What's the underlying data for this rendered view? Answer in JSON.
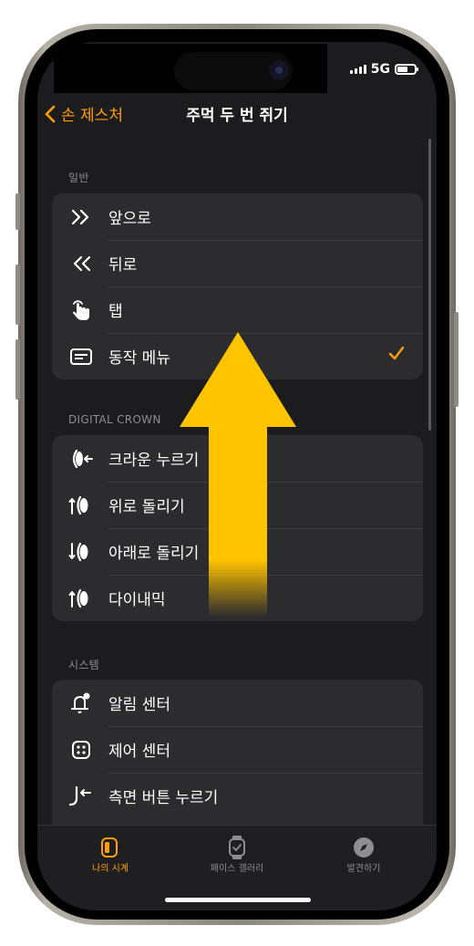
{
  "status": {
    "network": "5G"
  },
  "nav": {
    "back_label": "손 제스처",
    "title": "주먹 두 번 쥐기"
  },
  "accent_color": "#ff9f0a",
  "sections": {
    "general": {
      "header": "일반",
      "items": [
        {
          "label": "앞으로",
          "icon": "double-chevron-right-icon"
        },
        {
          "label": "뒤로",
          "icon": "double-chevron-left-icon"
        },
        {
          "label": "탭",
          "icon": "tap-hand-icon"
        },
        {
          "label": "동작 메뉴",
          "icon": "action-menu-icon",
          "selected": true
        }
      ]
    },
    "crown": {
      "header": "DIGITAL CROWN",
      "items": [
        {
          "label": "크라운 누르기",
          "icon": "crown-press-icon"
        },
        {
          "label": "위로 돌리기",
          "icon": "crown-rotate-up-icon"
        },
        {
          "label": "아래로 돌리기",
          "icon": "crown-rotate-down-icon"
        },
        {
          "label": "다이내믹",
          "icon": "crown-dynamic-icon"
        }
      ]
    },
    "system": {
      "header": "시스템",
      "items": [
        {
          "label": "알림 센터",
          "icon": "notification-bell-icon"
        },
        {
          "label": "제어 센터",
          "icon": "control-center-icon"
        },
        {
          "label": "측면 버튼 누르기",
          "icon": "side-button-icon"
        }
      ]
    }
  },
  "tabbar": {
    "tabs": [
      {
        "label": "나의 시계",
        "icon": "my-watch-icon",
        "active": true
      },
      {
        "label": "페이스 갤러리",
        "icon": "face-gallery-icon",
        "active": false
      },
      {
        "label": "발견하기",
        "icon": "discover-compass-icon",
        "active": false
      }
    ]
  },
  "overlay": {
    "arrow_color": "#ffc400",
    "arrow_direction": "up"
  }
}
